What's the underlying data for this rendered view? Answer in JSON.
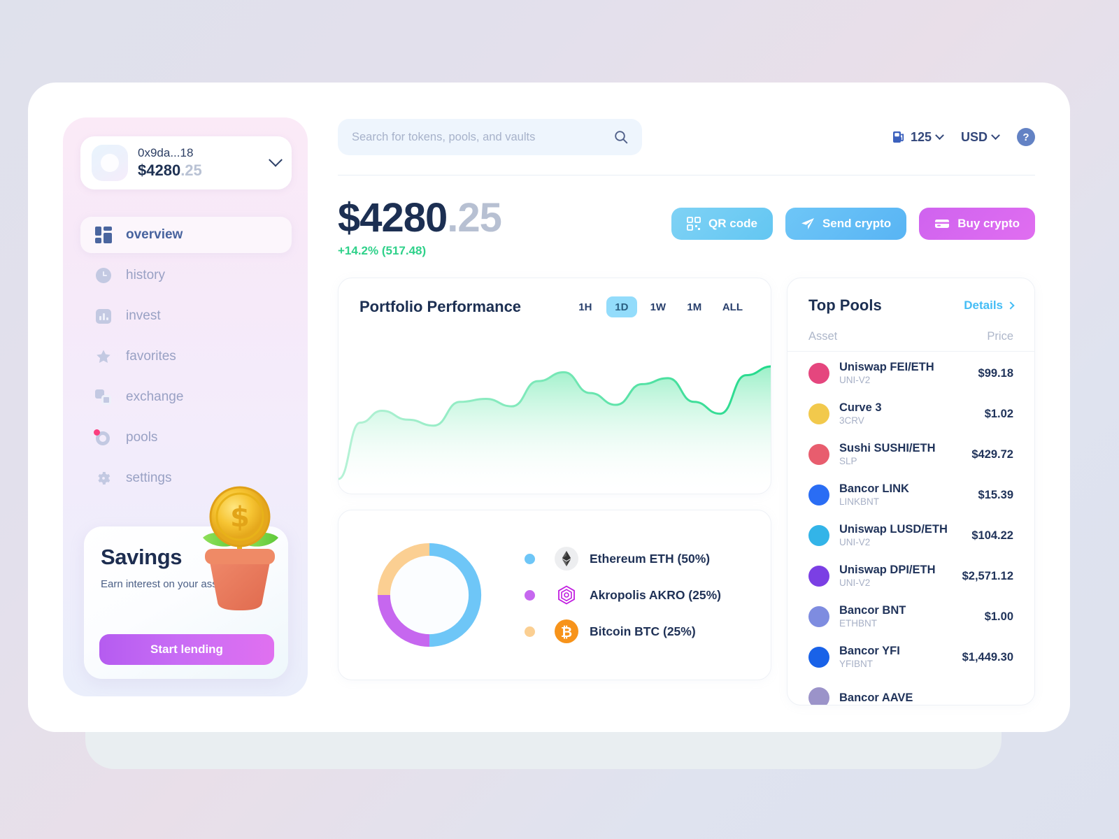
{
  "sidebar": {
    "wallet": {
      "address": "0x9da...18",
      "balance_main": "$4280",
      "balance_cents": ".25"
    },
    "nav": [
      {
        "label": "overview",
        "icon": "grid-icon",
        "active": true
      },
      {
        "label": "history",
        "icon": "clock-icon",
        "active": false
      },
      {
        "label": "invest",
        "icon": "bar-chart-icon",
        "active": false
      },
      {
        "label": "favorites",
        "icon": "star-icon",
        "active": false
      },
      {
        "label": "exchange",
        "icon": "exchange-icon",
        "active": false
      },
      {
        "label": "pools",
        "icon": "pools-icon",
        "active": false,
        "badge": true
      },
      {
        "label": "settings",
        "icon": "gear-icon",
        "active": false
      }
    ],
    "savings": {
      "title": "Savings",
      "subtitle": "Earn interest on your assets!",
      "cta": "Start lending"
    }
  },
  "topbar": {
    "search_placeholder": "Search for tokens, pools, and vaults",
    "search_value": "",
    "gas": "125",
    "currency": "USD",
    "help": "?"
  },
  "balance": {
    "main": "$4280",
    "cents": ".25",
    "change": "+14.2% (517.48)",
    "change_color": "#2fd18a"
  },
  "actions": [
    {
      "label": "QR code",
      "icon": "qr-code-icon",
      "color": "#63c6f2"
    },
    {
      "label": "Send crypto",
      "icon": "send-icon",
      "color": "#58b4f4"
    },
    {
      "label": "Buy crypto",
      "icon": "credit-card-icon",
      "color": "#d96af0"
    }
  ],
  "performance": {
    "title": "Portfolio Performance",
    "ranges": [
      "1H",
      "1D",
      "1W",
      "1M",
      "ALL"
    ],
    "active_range": "1D"
  },
  "allocation": [
    {
      "name": "Ethereum ETH (50%)",
      "percent": 50,
      "dot": "#6ec6f7",
      "coin": "eth-icon"
    },
    {
      "name": "Akropolis AKRO (25%)",
      "percent": 25,
      "dot": "#c667ef",
      "coin": "akro-icon"
    },
    {
      "name": "Bitcoin BTC (25%)",
      "percent": 25,
      "dot": "#fbcf92",
      "coin": "btc-icon"
    }
  ],
  "pools": {
    "title": "Top Pools",
    "details_label": "Details",
    "columns": {
      "asset": "Asset",
      "price": "Price"
    },
    "rows": [
      {
        "name": "Uniswap FEI/ETH",
        "symbol": "UNI-V2",
        "price": "$99.18",
        "color": "#e5467e"
      },
      {
        "name": "Curve 3",
        "symbol": "3CRV",
        "price": "$1.02",
        "color": "#f2c94c"
      },
      {
        "name": "Sushi SUSHI/ETH",
        "symbol": "SLP",
        "price": "$429.72",
        "color": "#e85d6e"
      },
      {
        "name": "Bancor LINK",
        "symbol": "LINKBNT",
        "price": "$15.39",
        "color": "#2a6df4"
      },
      {
        "name": "Uniswap LUSD/ETH",
        "symbol": "UNI-V2",
        "price": "$104.22",
        "color": "#33b4e8"
      },
      {
        "name": "Uniswap DPI/ETH",
        "symbol": "UNI-V2",
        "price": "$2,571.12",
        "color": "#7b3fe4"
      },
      {
        "name": "Bancor BNT",
        "symbol": "ETHBNT",
        "price": "$1.00",
        "color": "#7e8ce0"
      },
      {
        "name": "Bancor YFI",
        "symbol": "YFIBNT",
        "price": "$1,449.30",
        "color": "#1962e8"
      },
      {
        "name": "Bancor AAVE",
        "symbol": "",
        "price": "",
        "color": "#9b93c9"
      }
    ]
  },
  "chart_data": {
    "type": "area",
    "title": "Portfolio Performance",
    "xlabel": "",
    "ylabel": "",
    "grid": false,
    "legend": "none",
    "line_color": "#25d98c",
    "fill_gradient": [
      "#9cf0c8",
      "#ffffff"
    ],
    "x": [
      0,
      5,
      10,
      16,
      22,
      28,
      34,
      40,
      46,
      52,
      58,
      64,
      70,
      76,
      82,
      88,
      94,
      100
    ],
    "y": [
      8,
      46,
      54,
      48,
      44,
      60,
      62,
      57,
      74,
      80,
      66,
      58,
      72,
      76,
      60,
      52,
      78,
      84
    ],
    "ylim": [
      0,
      100
    ],
    "donut": {
      "type": "pie",
      "title": "",
      "categories": [
        "Ethereum ETH",
        "Akropolis AKRO",
        "Bitcoin BTC"
      ],
      "values": [
        50,
        25,
        25
      ],
      "colors": [
        "#6ec6f7",
        "#c667ef",
        "#fbcf92"
      ],
      "labels": [
        "Ethereum ETH (50%)",
        "Akropolis AKRO (25%)",
        "Bitcoin BTC (25%)"
      ]
    }
  }
}
